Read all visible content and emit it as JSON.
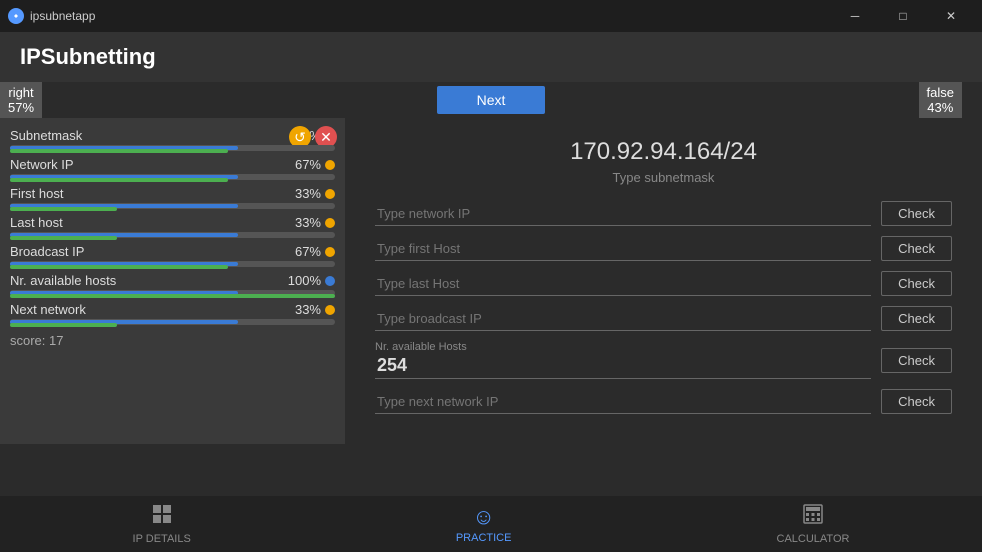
{
  "titlebar": {
    "app_name": "ipsubnetapp",
    "min_label": "─",
    "max_label": "□",
    "close_label": "✕"
  },
  "header": {
    "title": "IPSubnetting"
  },
  "next_bar": {
    "button_label": "Next",
    "score_right_label": "false",
    "score_right_pct": "43%",
    "score_left_label": "right",
    "score_left_pct": "57%"
  },
  "stats_panel": {
    "refresh_icon": "↺",
    "close_icon": "✕",
    "items": [
      {
        "name": "Subnetmask",
        "pct": "67%",
        "blue_width": 70,
        "green_width": 67,
        "indicator": "blue"
      },
      {
        "name": "Network IP",
        "pct": "67%",
        "blue_width": 70,
        "green_width": 67,
        "indicator": "orange"
      },
      {
        "name": "First host",
        "pct": "33%",
        "blue_width": 70,
        "green_width": 33,
        "indicator": "orange"
      },
      {
        "name": "Last host",
        "pct": "33%",
        "blue_width": 70,
        "green_width": 33,
        "indicator": "orange"
      },
      {
        "name": "Broadcast IP",
        "pct": "67%",
        "blue_width": 70,
        "green_width": 67,
        "indicator": "orange"
      },
      {
        "name": "Nr. available hosts",
        "pct": "100%",
        "blue_width": 70,
        "green_width": 100,
        "indicator": "blue"
      },
      {
        "name": "Next network",
        "pct": "33%",
        "blue_width": 70,
        "green_width": 33,
        "indicator": "orange"
      }
    ],
    "score_label": "score: 17"
  },
  "practice": {
    "ip_address": "170.92.94.164/24",
    "subtitle": "Type subnetmask",
    "fields": [
      {
        "placeholder": "Type network IP",
        "check_label": "Check"
      },
      {
        "placeholder": "Type first Host",
        "check_label": "Check"
      },
      {
        "placeholder": "Type last Host",
        "check_label": "Check"
      },
      {
        "placeholder": "Type broadcast IP",
        "check_label": "Check"
      },
      {
        "value": "254",
        "sublabel": "Nr. available Hosts",
        "check_label": "Check"
      },
      {
        "placeholder": "Type next network IP",
        "check_label": "Check"
      }
    ]
  },
  "bottom_nav": {
    "items": [
      {
        "icon": "▦",
        "label": "IP DETAILS",
        "active": false
      },
      {
        "icon": "☺",
        "label": "PRACTICE",
        "active": true
      },
      {
        "icon": "▦",
        "label": "CALCULATOR",
        "active": false
      }
    ]
  }
}
